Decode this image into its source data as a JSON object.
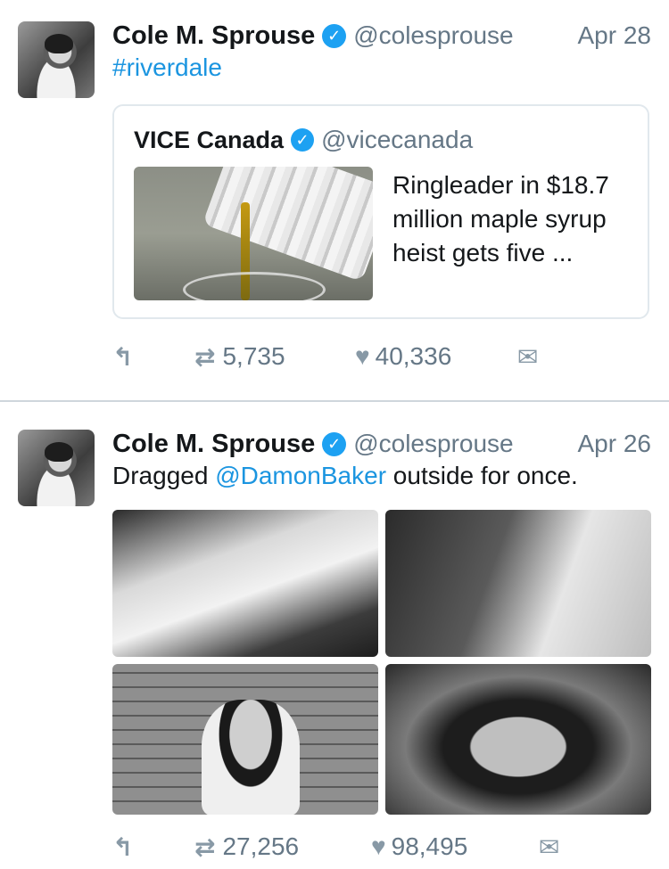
{
  "tweets": [
    {
      "author": "Cole M. Sprouse",
      "verified_icon": "verified-badge-icon",
      "handle": "@colesprouse",
      "date": "Apr 28",
      "text": "#riverdale",
      "quote": {
        "author": "VICE Canada",
        "handle": "@vicecanada",
        "text": "Ringleader in $18.7 million maple syrup heist gets five ..."
      },
      "actions": {
        "retweets": "5,735",
        "likes": "40,336"
      }
    },
    {
      "author": "Cole M. Sprouse",
      "verified_icon": "verified-badge-icon",
      "handle": "@colesprouse",
      "date": "Apr 26",
      "text_before": "Dragged ",
      "mention": "@DamonBaker",
      "text_after": " outside for once.",
      "actions": {
        "retweets": "27,256",
        "likes": "98,495"
      }
    }
  ],
  "colors": {
    "link": "#1b95e0",
    "verified": "#1da1f2",
    "muted": "#657786"
  }
}
